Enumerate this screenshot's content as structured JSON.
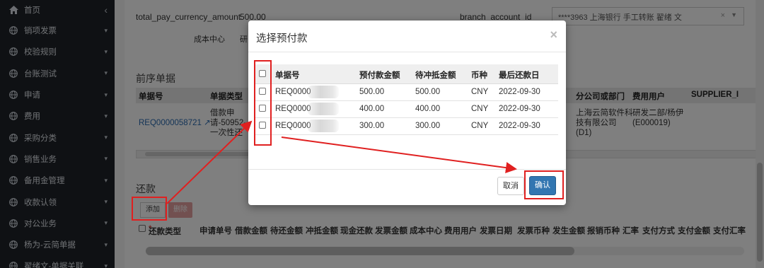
{
  "sidebar": {
    "items": [
      {
        "label": "首页",
        "icon": "home-icon",
        "arrow": "‹"
      },
      {
        "label": "销项发票",
        "icon": "globe-icon",
        "arrow": "▾"
      },
      {
        "label": "校验规则",
        "icon": "globe-icon",
        "arrow": "▾"
      },
      {
        "label": "台账测试",
        "icon": "globe-icon",
        "arrow": "▾"
      },
      {
        "label": "申请",
        "icon": "globe-icon",
        "arrow": "▾"
      },
      {
        "label": "费用",
        "icon": "globe-icon",
        "arrow": "▾"
      },
      {
        "label": "采购分类",
        "icon": "globe-icon",
        "arrow": "▾"
      },
      {
        "label": "销售业务",
        "icon": "globe-icon",
        "arrow": "▾"
      },
      {
        "label": "备用金管理",
        "icon": "globe-icon",
        "arrow": "▾"
      },
      {
        "label": "收款认领",
        "icon": "globe-icon",
        "arrow": "▾"
      },
      {
        "label": "对公业务",
        "icon": "globe-icon",
        "arrow": "▾"
      },
      {
        "label": "杨为-云简单据",
        "icon": "globe-icon",
        "arrow": "▾"
      },
      {
        "label": "翟绪文-单据关联",
        "icon": "globe-icon",
        "arrow": "▾"
      }
    ]
  },
  "form": {
    "pay_amount_label": "total_pay_currency_amount",
    "pay_amount_value": "500.00",
    "branch_label": "branch_account_id",
    "branch_value": "****3963 上海银行 手工转账 翟绪 文",
    "branch_clear": "×",
    "cost_center_label": "成本中心",
    "cost_center_value": "研"
  },
  "prev_docs": {
    "title": "前序单据",
    "headers": [
      "单据号",
      "单据类型",
      "分公司或部门",
      "费用用户",
      "SUPPLIER_I"
    ],
    "row": {
      "doc_no": "REQ0000058721",
      "doc_type_lines": [
        "借款申",
        "请-50952-",
        "一次性还"
      ],
      "company_lines": [
        "上海云简软件科",
        "技有限公司",
        "(D1)"
      ],
      "user_lines": [
        "研发二部/杨伊",
        "(E000019)"
      ]
    }
  },
  "repay": {
    "title": "还款",
    "add_label": "添加",
    "delete_label": "删除",
    "headers": [
      "还款类型",
      "申请单号",
      "借款金额",
      "待还金额",
      "冲抵金额",
      "现金还款",
      "发票金额",
      "成本中心",
      "费用用户",
      "发票日期",
      "发票币种",
      "发生金额",
      "报销币种",
      "汇率",
      "支付方式",
      "支付金额",
      "支付汇率"
    ],
    "required_mark": "*"
  },
  "modal": {
    "title": "选择预付款",
    "close": "×",
    "headers": [
      "单据号",
      "预付款金额",
      "待冲抵金额",
      "币种",
      "最后还款日"
    ],
    "rows": [
      {
        "doc_no": "REQ0000",
        "amount": "500.00",
        "pending": "500.00",
        "currency": "CNY",
        "due": "2022-09-30"
      },
      {
        "doc_no": "REQ0000",
        "amount": "400.00",
        "pending": "400.00",
        "currency": "CNY",
        "due": "2022-09-30"
      },
      {
        "doc_no": "REQ0000",
        "amount": "300.00",
        "pending": "300.00",
        "currency": "CNY",
        "due": "2022-09-30"
      }
    ],
    "cancel_label": "取消",
    "confirm_label": "确认"
  },
  "colors": {
    "sidebar_bg": "#1f2329",
    "primary": "#3276b1",
    "danger_light": "#e4a1a1",
    "annotation_red": "#e02020",
    "link": "#2a6ab0"
  }
}
